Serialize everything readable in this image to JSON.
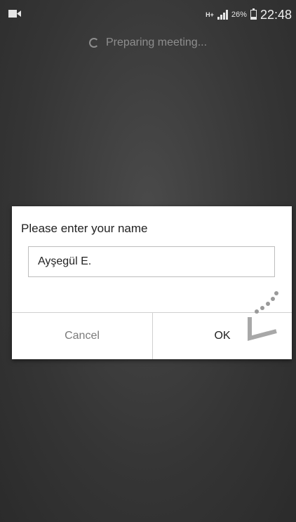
{
  "status_bar": {
    "camera_icon": "video-camera-icon",
    "network_label": "H+",
    "battery_percent": "26%",
    "battery_level": 0.26,
    "time": "22:48"
  },
  "loading": {
    "text": "Preparing meeting..."
  },
  "dialog": {
    "title": "Please enter your name",
    "name_value": "Ayşegül E.",
    "cancel_label": "Cancel",
    "ok_label": "OK"
  },
  "colors": {
    "background": "#3a3a3a",
    "dialog_bg": "#ffffff",
    "cancel_text": "#7a7a7a",
    "ok_text": "#222222"
  }
}
